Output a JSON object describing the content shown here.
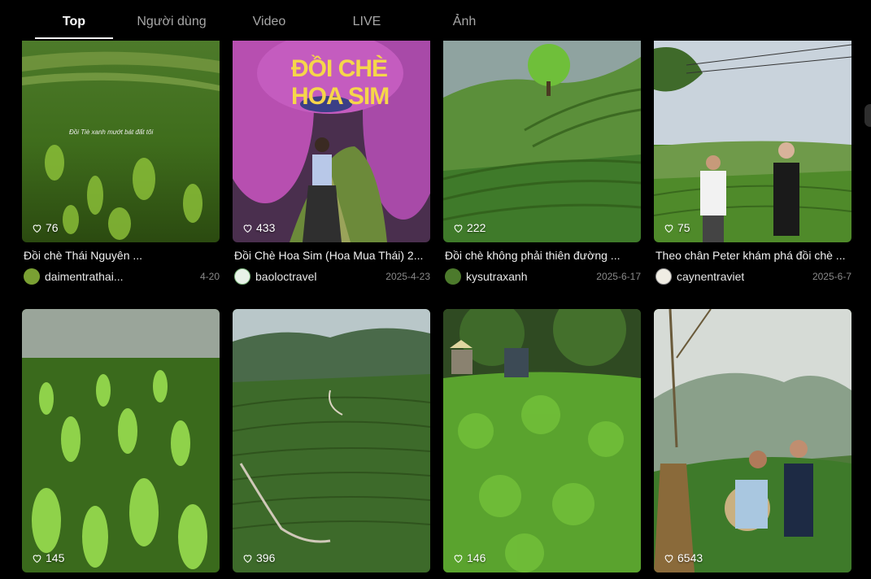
{
  "tabs": [
    {
      "label": "Top"
    },
    {
      "label": "Người dùng"
    },
    {
      "label": "Video"
    },
    {
      "label": "LIVE"
    },
    {
      "label": "Ảnh"
    }
  ],
  "heart_icon": "heart-outline-icon",
  "videos": [
    {
      "likes": "76",
      "title": "Đồi chè Thái Nguyên ...",
      "author": "daimentrathai...",
      "date": "4-20",
      "overlay_text": "Đồi Tiè xanh mướt bát đất tôi"
    },
    {
      "likes": "433",
      "title": "Đồi Chè Hoa Sim (Hoa Mua Thái) 2...",
      "author": "baoloctravel",
      "date": "2025-4-23",
      "overlay_text": "ĐỒI CHÈ HOA SIM"
    },
    {
      "likes": "222",
      "title": "Đồi chè không phải thiên đường ...",
      "author": "kysutraxanh",
      "date": "2025-6-17"
    },
    {
      "likes": "75",
      "title": "Theo chân Peter khám phá đồi chè ...",
      "author": "caynentraviet",
      "date": "2025-6-7"
    },
    {
      "likes": "145"
    },
    {
      "likes": "396"
    },
    {
      "likes": "146"
    },
    {
      "likes": "6543"
    }
  ],
  "colors": {
    "background": "#000000",
    "tab_inactive": "#a7a7a7",
    "date": "#8a8a8a"
  }
}
